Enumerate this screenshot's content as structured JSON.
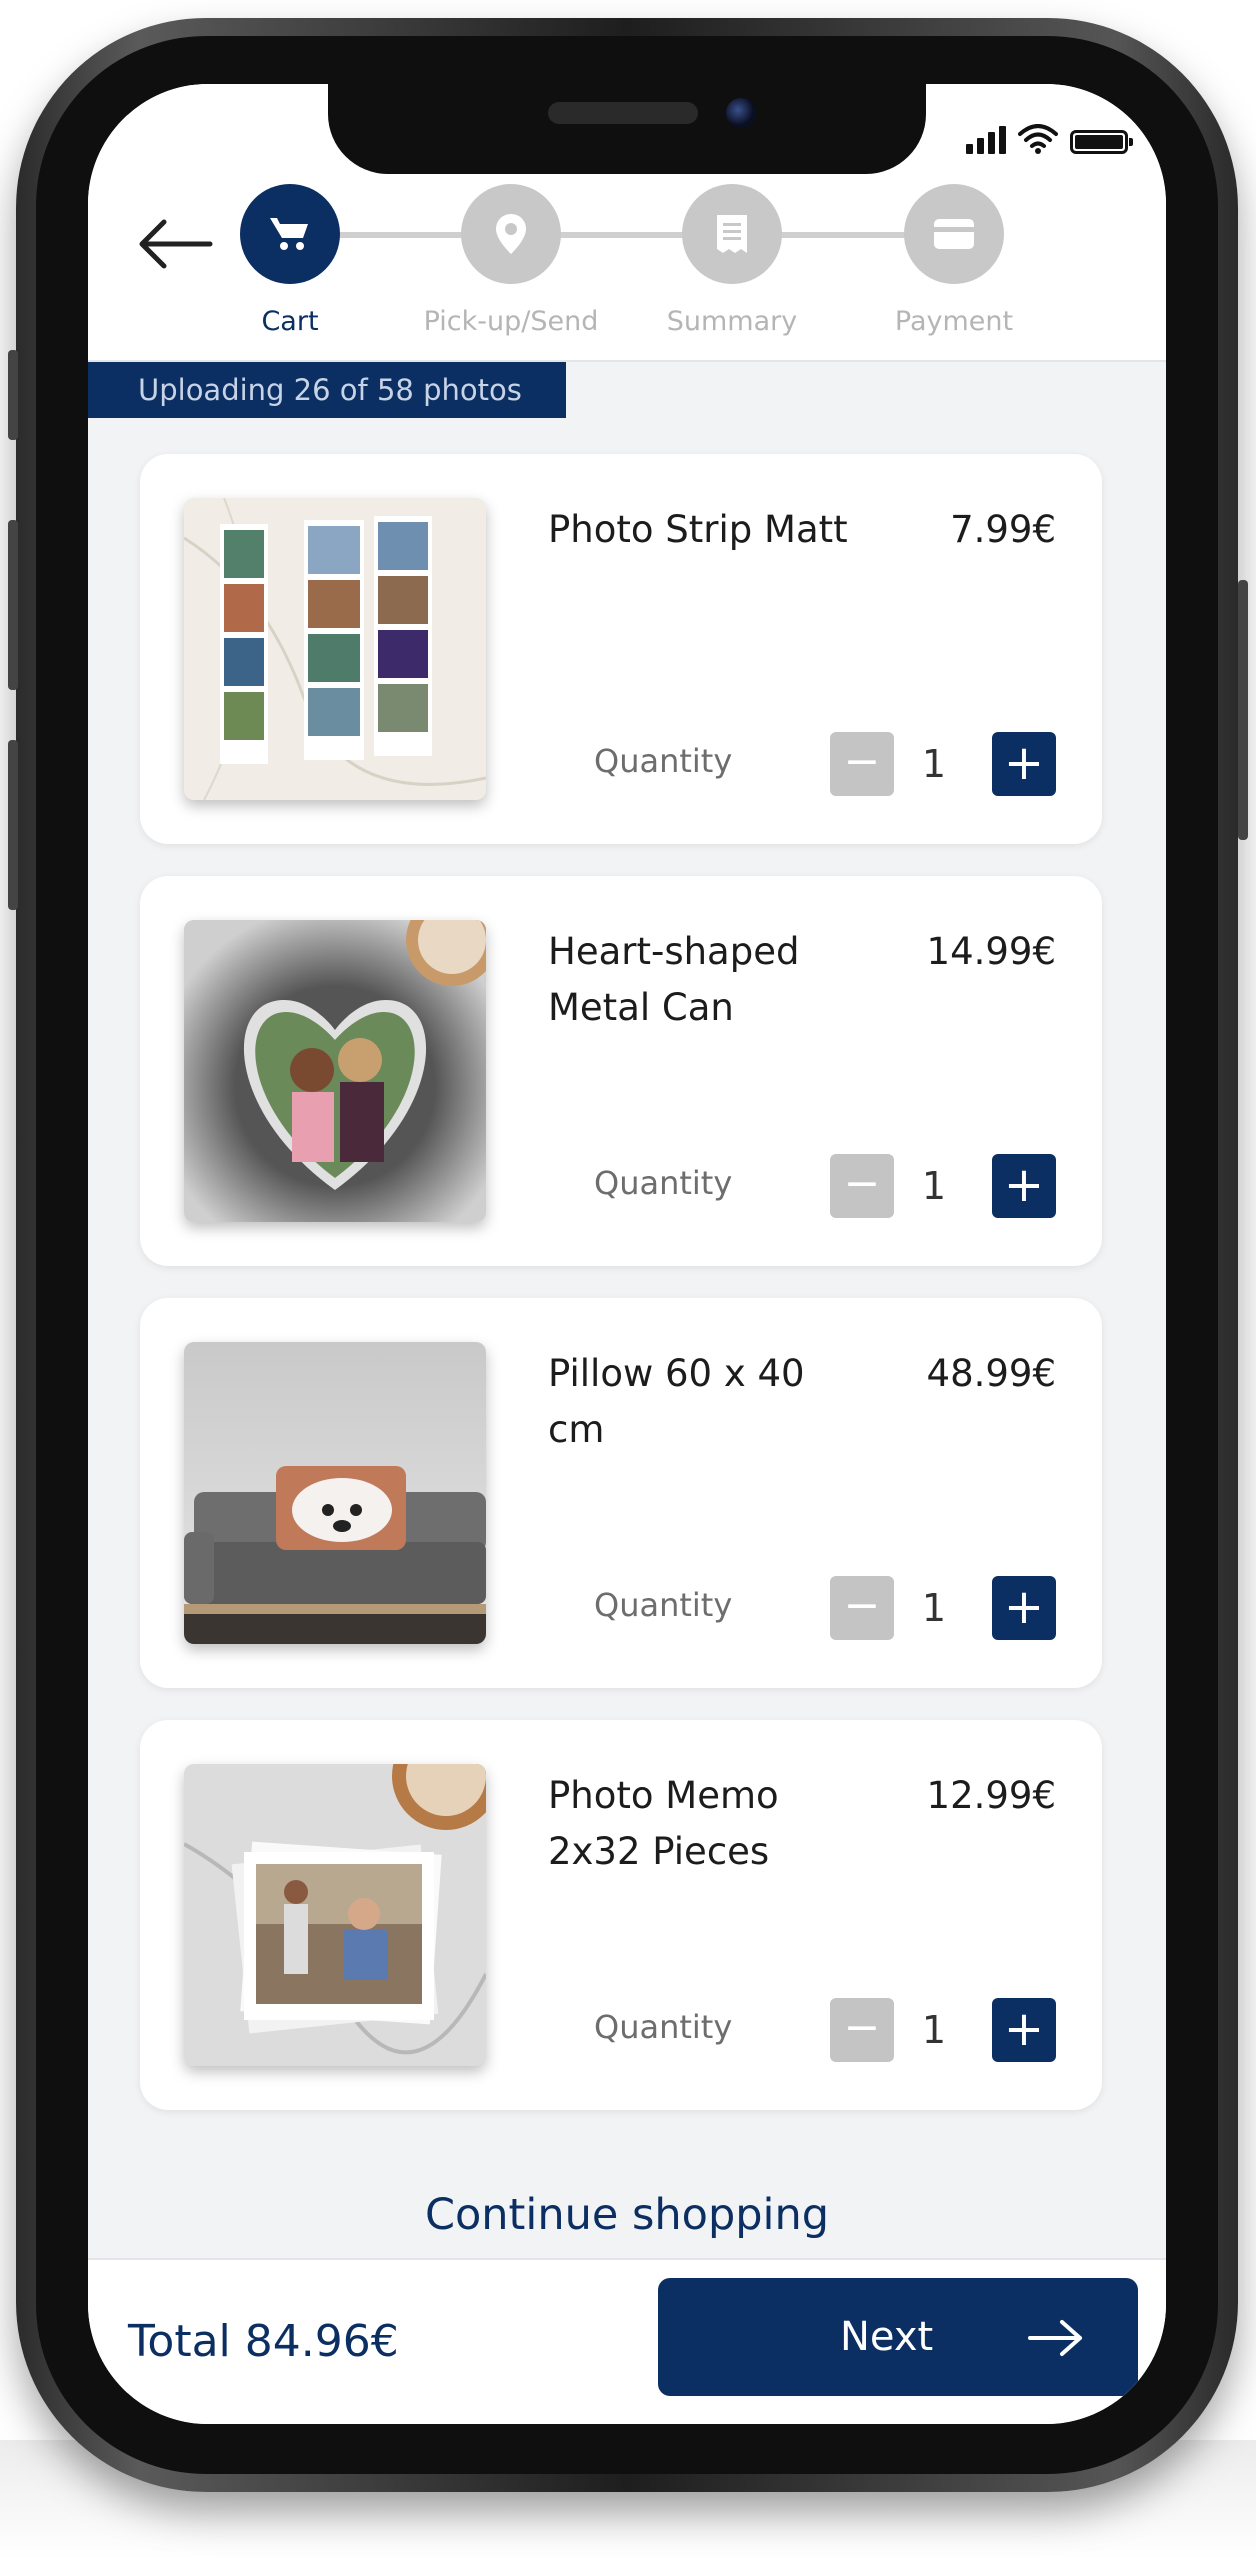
{
  "steps": [
    {
      "label": "Cart",
      "icon": "cart-icon",
      "active": true
    },
    {
      "label": "Pick-up/Send",
      "icon": "location-pin-icon",
      "active": false
    },
    {
      "label": "Summary",
      "icon": "receipt-icon",
      "active": false
    },
    {
      "label": "Payment",
      "icon": "credit-card-icon",
      "active": false
    }
  ],
  "upload_status": "Uploading 26 of 58 photos",
  "items": [
    {
      "name": "Photo Strip Matt",
      "price": "7.99€",
      "quantity_label": "Quantity",
      "quantity": "1",
      "minus": "−",
      "plus": "+"
    },
    {
      "name": "Heart-shaped Metal Can",
      "price": "14.99€",
      "quantity_label": "Quantity",
      "quantity": "1",
      "minus": "−",
      "plus": "+"
    },
    {
      "name": "Pillow 60 x 40 cm",
      "price": "48.99€",
      "quantity_label": "Quantity",
      "quantity": "1",
      "minus": "−",
      "plus": "+"
    },
    {
      "name": "Photo Memo 2x32 Pieces",
      "price": "12.99€",
      "quantity_label": "Quantity",
      "quantity": "1",
      "minus": "−",
      "plus": "+"
    }
  ],
  "continue_shopping": "Continue shopping",
  "total": "Total 84.96€",
  "next_label": "Next",
  "colors": {
    "primary": "#0c2f63",
    "inactive_step": "#c8c8c8",
    "background": "#f2f3f5"
  }
}
